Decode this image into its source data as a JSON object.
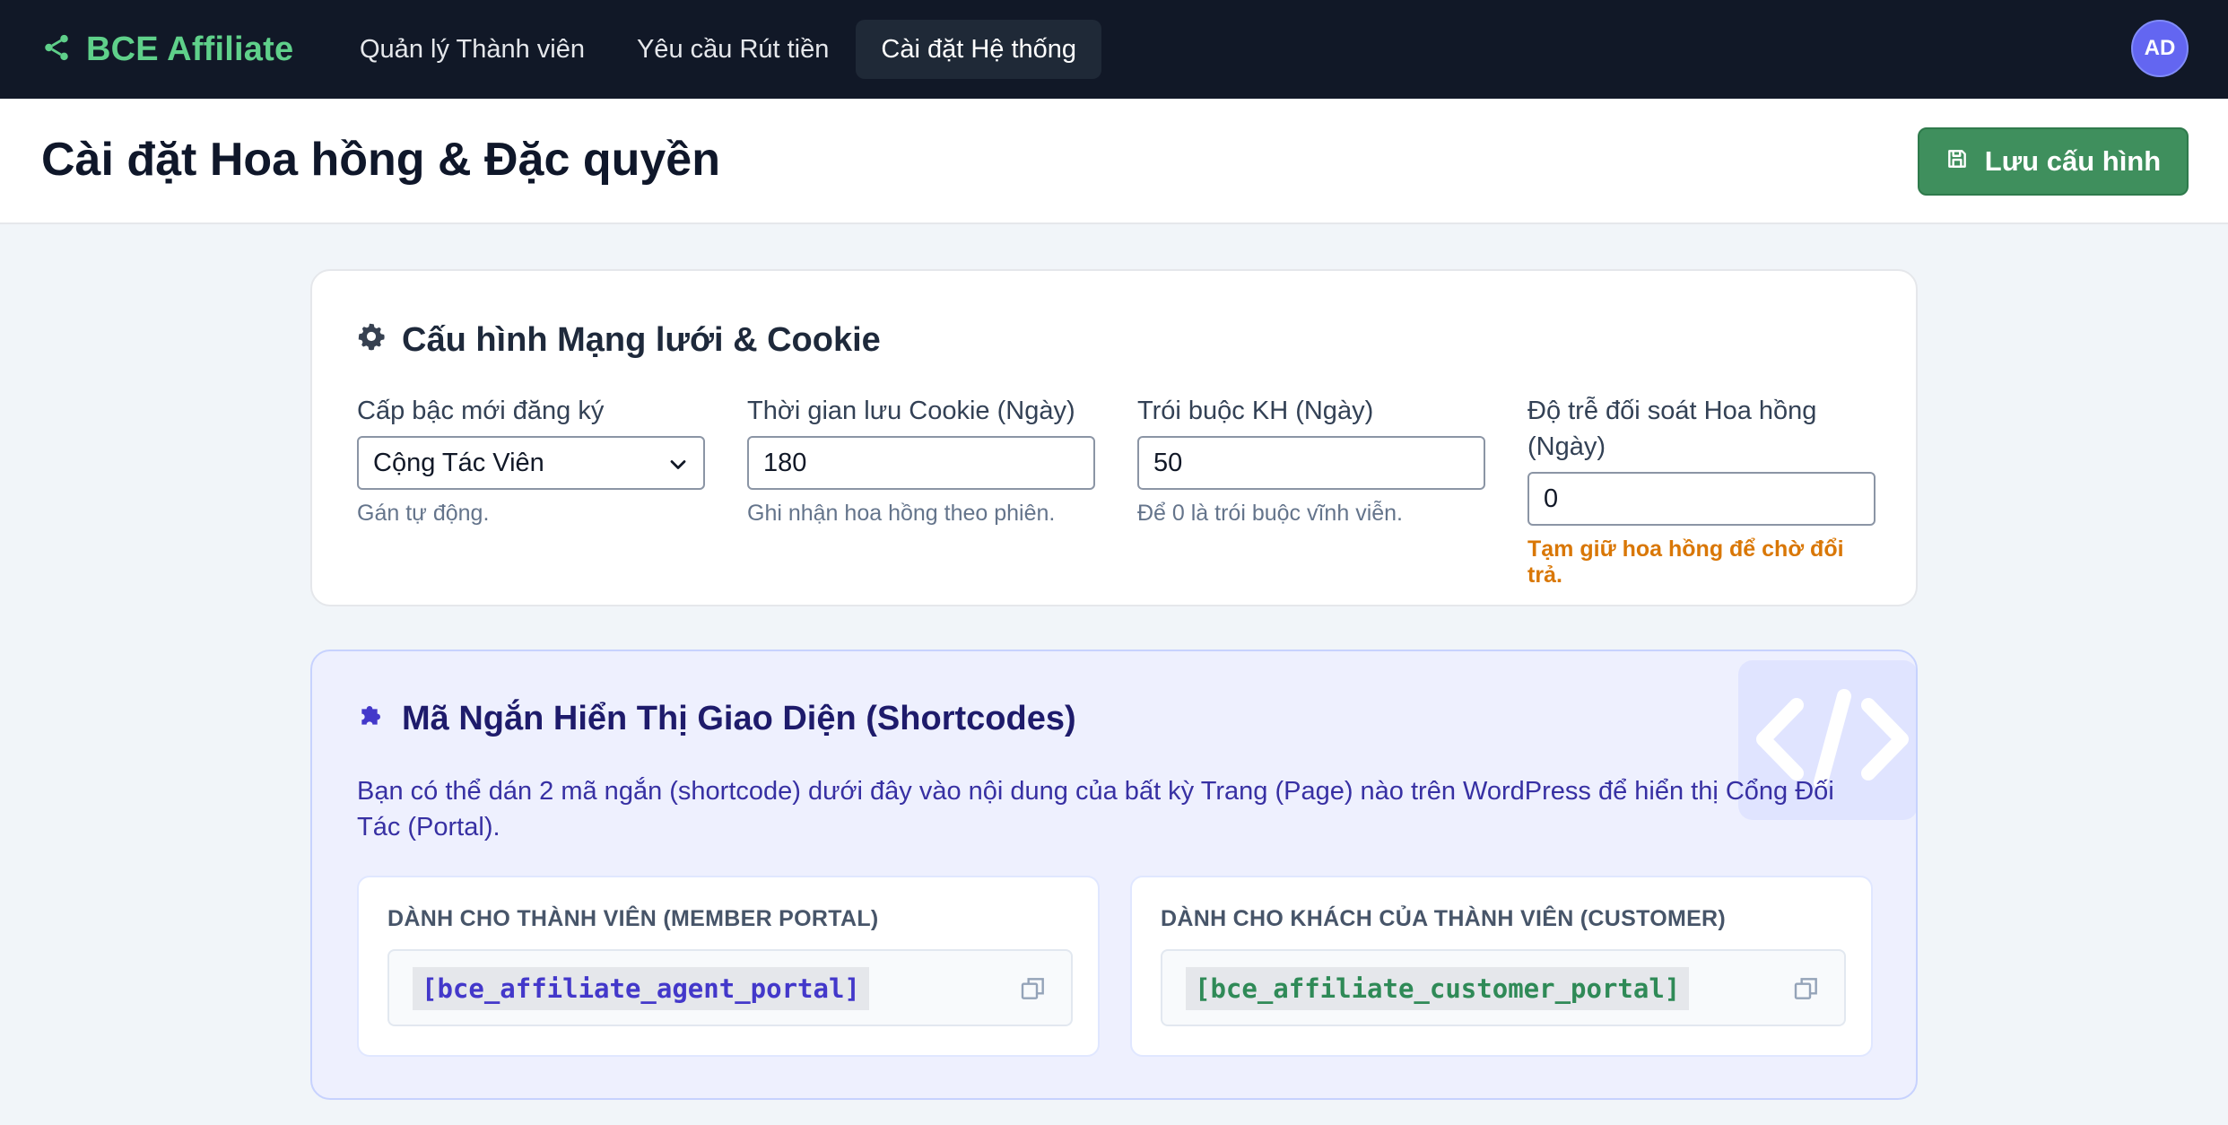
{
  "nav": {
    "brand": "BCE Affiliate",
    "items": [
      {
        "label": "Quản lý Thành viên",
        "active": false
      },
      {
        "label": "Yêu cầu Rút tiền",
        "active": false
      },
      {
        "label": "Cài đặt Hệ thống",
        "active": true
      }
    ],
    "avatar_initials": "AD"
  },
  "header": {
    "title": "Cài đặt Hoa hồng & Đặc quyền",
    "save_label": "Lưu cấu hình"
  },
  "network": {
    "title": "Cấu hình Mạng lưới & Cookie",
    "fields": [
      {
        "label": "Cấp bậc mới đăng ký",
        "value": "Cộng Tác Viên",
        "hint": "Gán tự động."
      },
      {
        "label": "Thời gian lưu Cookie (Ngày)",
        "value": "180",
        "hint": "Ghi nhận hoa hồng theo phiên."
      },
      {
        "label": "Trói buộc KH (Ngày)",
        "value": "50",
        "hint": "Để 0 là trói buộc vĩnh viễn."
      },
      {
        "label": "Độ trễ đối soát Hoa hồng (Ngày)",
        "value": "0",
        "hint": "Tạm giữ hoa hồng để chờ đổi trả."
      }
    ]
  },
  "shortcodes": {
    "title": "Mã Ngắn Hiển Thị Giao Diện (Shortcodes)",
    "description": "Bạn có thể dán 2 mã ngắn (shortcode) dưới đây vào nội dung của bất kỳ Trang (Page) nào trên WordPress để hiển thị Cổng Đối Tác (Portal).",
    "items": [
      {
        "label": "DÀNH CHO THÀNH VIÊN (MEMBER PORTAL)",
        "code": "[bce_affiliate_agent_portal]",
        "color": "#4338ca"
      },
      {
        "label": "DÀNH CHO KHÁCH CỦA THÀNH VIÊN (CUSTOMER)",
        "code": "[bce_affiliate_customer_portal]",
        "color": "#2f8a57"
      }
    ]
  },
  "colors": {
    "nav_bg": "#111827",
    "brand": "#5fd08a",
    "save_button": "#3f8f5d",
    "avatar": "#6366f1",
    "warn_hint": "#d97706"
  }
}
